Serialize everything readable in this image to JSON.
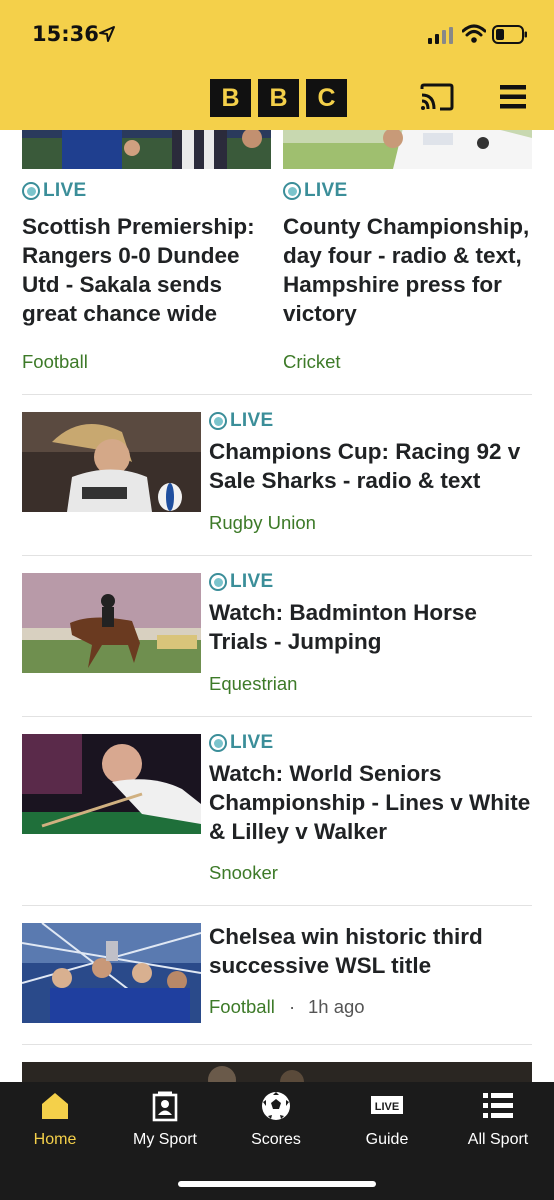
{
  "status_bar": {
    "time": "15:36"
  },
  "header": {
    "logo": [
      "B",
      "B",
      "C"
    ],
    "cast_icon": "cast-icon",
    "menu_icon": "menu-icon"
  },
  "colors": {
    "header_bg": "#f4d04a",
    "live": "#3b8e99",
    "category": "#3d7a28",
    "tabbar_bg": "#1b1b1b",
    "active_tab": "#f4d04a"
  },
  "stories": {
    "top_left": {
      "live": "LIVE",
      "headline_lines": [
        "Scottish Premiership:",
        "Rangers 0-0 Dundee",
        "Utd - Sakala sends",
        "great chance wide"
      ],
      "category": "Football"
    },
    "top_right": {
      "live": "LIVE",
      "headline_lines": [
        "County Championship,",
        "day four - radio & text,",
        "Hampshire press for",
        "victory"
      ],
      "category": "Cricket"
    },
    "list": [
      {
        "live": "LIVE",
        "headline_lines": [
          "Champions Cup: Racing 92 v",
          "Sale Sharks - radio & text"
        ],
        "category": "Rugby Union"
      },
      {
        "live": "LIVE",
        "headline_lines": [
          "Watch: Badminton Horse",
          "Trials - Jumping"
        ],
        "category": "Equestrian"
      },
      {
        "live": "LIVE",
        "headline_lines": [
          "Watch: World Seniors",
          "Championship - Lines v White",
          "& Lilley v Walker"
        ],
        "category": "Snooker"
      },
      {
        "headline_lines": [
          "Chelsea win historic third",
          "successive WSL title"
        ],
        "category": "Football",
        "separator": "·",
        "time": "1h ago"
      }
    ]
  },
  "tabs": [
    {
      "label": "Home",
      "icon": "home-icon",
      "active": true
    },
    {
      "label": "My Sport",
      "icon": "my-sport-icon",
      "active": false
    },
    {
      "label": "Scores",
      "icon": "football-icon",
      "active": false
    },
    {
      "label": "Guide",
      "icon": "live-guide-icon",
      "badge": "LIVE",
      "active": false
    },
    {
      "label": "All Sport",
      "icon": "list-icon",
      "active": false
    }
  ]
}
